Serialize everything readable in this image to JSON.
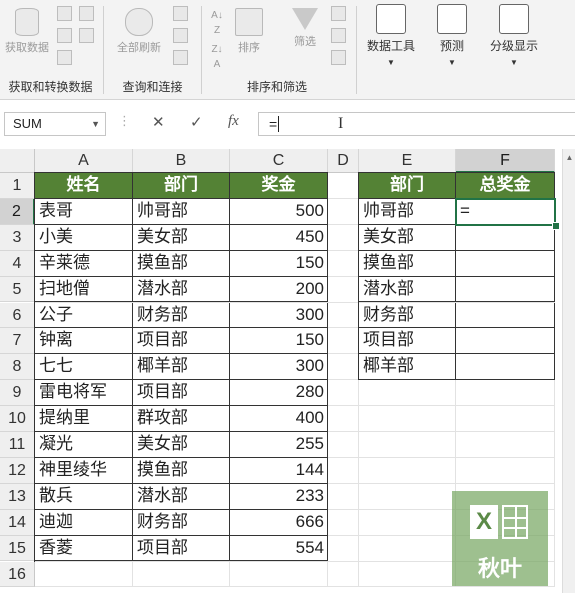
{
  "ribbon": {
    "groups": [
      {
        "label": "获取和转换数据",
        "buttons": [
          {
            "label": "获取数据",
            "icon": "database-icon"
          }
        ]
      },
      {
        "label": "查询和连接",
        "buttons": [
          {
            "label": "全部刷新",
            "icon": "refresh-icon"
          }
        ]
      },
      {
        "label": "排序和筛选",
        "buttons": [
          {
            "label": "排序",
            "icon": "sort-icon"
          },
          {
            "label": "筛选",
            "icon": "filter-icon"
          }
        ]
      },
      {
        "label": "",
        "buttons": [
          {
            "label": "数据工具",
            "icon": "data-tools-icon"
          },
          {
            "label": "预测",
            "icon": "forecast-icon"
          },
          {
            "label": "分级显示",
            "icon": "outline-icon"
          }
        ]
      }
    ]
  },
  "formula_bar": {
    "name_box": "SUM",
    "cancel_icon": "✕",
    "enter_icon": "✓",
    "fx_label": "fx",
    "formula": "="
  },
  "sheet": {
    "columns": [
      "A",
      "B",
      "C",
      "D",
      "E",
      "F"
    ],
    "rows": [
      "1",
      "2",
      "3",
      "4",
      "5",
      "6",
      "7",
      "8",
      "9",
      "10",
      "11",
      "12",
      "13",
      "14",
      "15",
      "16"
    ],
    "table1_headers": [
      "姓名",
      "部门",
      "奖金"
    ],
    "table1_rows": [
      [
        "表哥",
        "帅哥部",
        "500"
      ],
      [
        "小美",
        "美女部",
        "450"
      ],
      [
        "辛莱德",
        "摸鱼部",
        "150"
      ],
      [
        "扫地僧",
        "潜水部",
        "200"
      ],
      [
        "公子",
        "财务部",
        "300"
      ],
      [
        "钟离",
        "项目部",
        "150"
      ],
      [
        "七七",
        "椰羊部",
        "300"
      ],
      [
        "雷电将军",
        "项目部",
        "280"
      ],
      [
        "提纳里",
        "群攻部",
        "400"
      ],
      [
        "凝光",
        "美女部",
        "255"
      ],
      [
        "神里绫华",
        "摸鱼部",
        "144"
      ],
      [
        "散兵",
        "潜水部",
        "233"
      ],
      [
        "迪迦",
        "财务部",
        "666"
      ],
      [
        "香菱",
        "项目部",
        "554"
      ]
    ],
    "table2_headers": [
      "部门",
      "总奖金"
    ],
    "table2_rows": [
      [
        "帅哥部",
        "="
      ],
      [
        "美女部",
        ""
      ],
      [
        "摸鱼部",
        ""
      ],
      [
        "潜水部",
        ""
      ],
      [
        "财务部",
        ""
      ],
      [
        "项目部",
        ""
      ],
      [
        "椰羊部",
        ""
      ]
    ],
    "header_fill": "#548235",
    "selection_color": "#217346"
  },
  "watermark": {
    "logo_text": "X",
    "caption": "秋叶"
  }
}
